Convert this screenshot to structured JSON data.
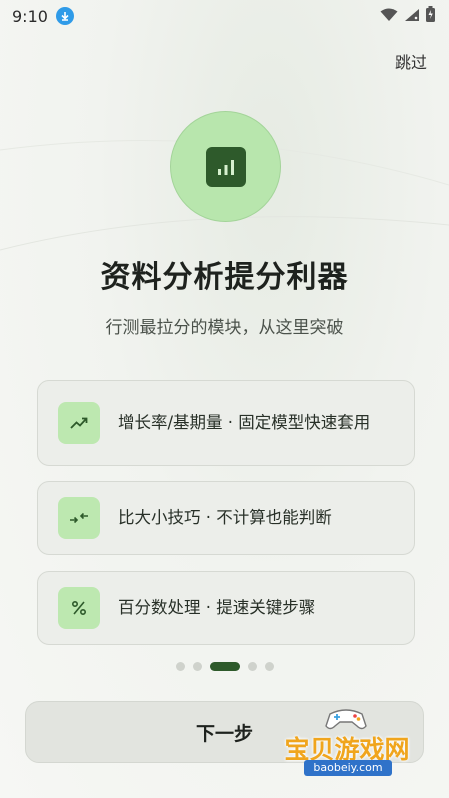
{
  "status_bar": {
    "time": "9:10"
  },
  "skip_label": "跳过",
  "title": "资料分析提分利器",
  "subtitle": "行测最拉分的模块，从这里突破",
  "features": [
    {
      "icon": "trending-up-icon",
      "text": "增长率/基期量 · 固定模型快速套用"
    },
    {
      "icon": "compare-arrows-icon",
      "text": "比大小技巧 · 不计算也能判断"
    },
    {
      "icon": "percent-icon",
      "text": "百分数处理 · 提速关键步骤"
    }
  ],
  "pager": {
    "count": 5,
    "active_index": 2
  },
  "next_label": "下一步",
  "watermark": {
    "text": "宝贝游戏网",
    "url": "baobeiy.com"
  },
  "colors": {
    "accent": "#2e5a2b",
    "icon_bg": "#bde8b0",
    "hero_bg": "#b8e6ad"
  }
}
